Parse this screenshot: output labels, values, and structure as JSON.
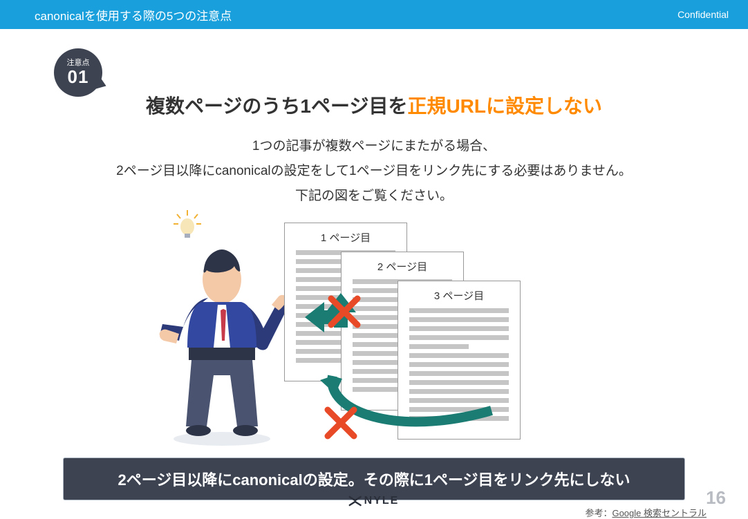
{
  "header": {
    "title": "canonicalを使用する際の5つの注意点",
    "confidential": "Confidential"
  },
  "badge": {
    "label": "注意点",
    "number": "01"
  },
  "title": {
    "prefix": "複数ページのうち1ページ目を",
    "accent": "正規URLに設定しない"
  },
  "description": {
    "line1": "1つの記事が複数ページにまたがる場合、",
    "line2": "2ページ目以降にcanonicalの設定をして1ページ目をリンク先にする必要はありません。",
    "line3": "下記の図をご覧ください。"
  },
  "pages": {
    "p1": "1 ページ目",
    "p2": "2 ページ目",
    "p3": "3 ページ目"
  },
  "banner": "2ページ目以降にcanonicalの設定。その際に1ページ目をリンク先にしない",
  "reference": {
    "prefix": "参考：",
    "link": "Google 検索セントラル"
  },
  "footer": {
    "logo": "NYLE",
    "pagenum": "16"
  }
}
